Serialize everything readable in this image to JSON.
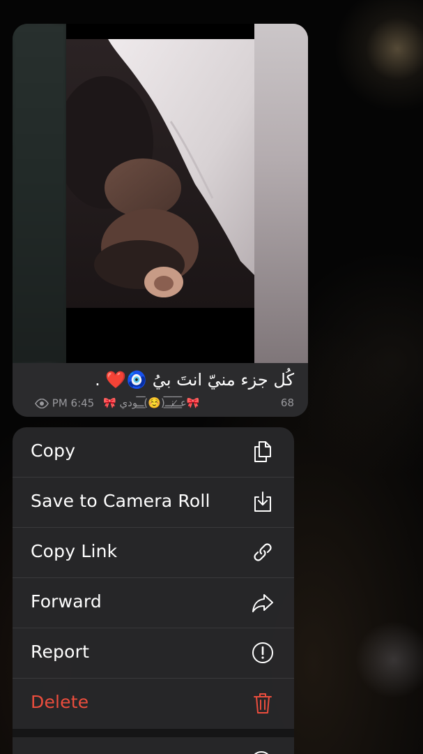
{
  "message": {
    "caption": "كُل جزء منيّ انتَ بيُ 🧿❤️ .",
    "views": "68",
    "signature": "🎀عـ̷͟͞͞ـنـ͟͞͞ـ(☺️)ـ͟͞͞ـودي 🎀",
    "time": "PM 6:45",
    "view_icon": "eye-icon"
  },
  "menu": {
    "items": [
      {
        "label": "Copy",
        "icon": "copy-icon"
      },
      {
        "label": "Save to Camera Roll",
        "icon": "download-icon"
      },
      {
        "label": "Copy Link",
        "icon": "link-icon"
      },
      {
        "label": "Forward",
        "icon": "forward-arrow-icon"
      },
      {
        "label": "Report",
        "icon": "exclamation-circle-icon"
      },
      {
        "label": "Delete",
        "icon": "trash-icon"
      }
    ],
    "danger_color": "#eb4d3d"
  }
}
